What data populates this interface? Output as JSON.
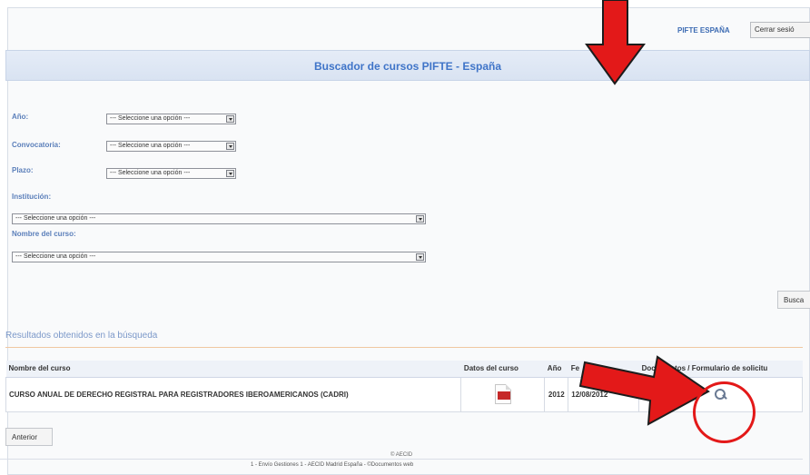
{
  "header": {
    "pifte_label": "PIFTE ESPAÑA",
    "logout_label": "Cerrar sesió"
  },
  "page": {
    "title": "Buscador de cursos PIFTE - España"
  },
  "filters": {
    "year_label": "Año:",
    "convocatoria_label": "Convocatoria:",
    "plazo_label": "Plazo:",
    "institucion_label": "Institución:",
    "curso_label": "Nombre del curso:",
    "select_placeholder": "--- Seleccione una opción ---",
    "select_placeholder_wide": "--- Seleccione una opción ---"
  },
  "actions": {
    "search_label": "Busca",
    "back_label": "Anterior"
  },
  "results": {
    "label": "Resultados obtenidos en la búsqueda",
    "headers": {
      "name": "Nombre del curso",
      "data": "Datos del curso",
      "year": "Año",
      "date": "Fe",
      "doc": "Documentos / Formulario de solicitu"
    },
    "rows": [
      {
        "name": "CURSO ANUAL DE DERECHO REGISTRAL PARA REGISTRADORES IBEROAMERICANOS (CADRI)",
        "year": "2012",
        "date": "12/08/2012"
      }
    ]
  },
  "footer": {
    "copyright": "© AECID",
    "line": "1 - Envío Gestiones 1 - AECID Madrid España - ©Documentos web"
  },
  "annotations": {
    "arrow_color": "#e31919",
    "circle_color": "#e31919"
  }
}
